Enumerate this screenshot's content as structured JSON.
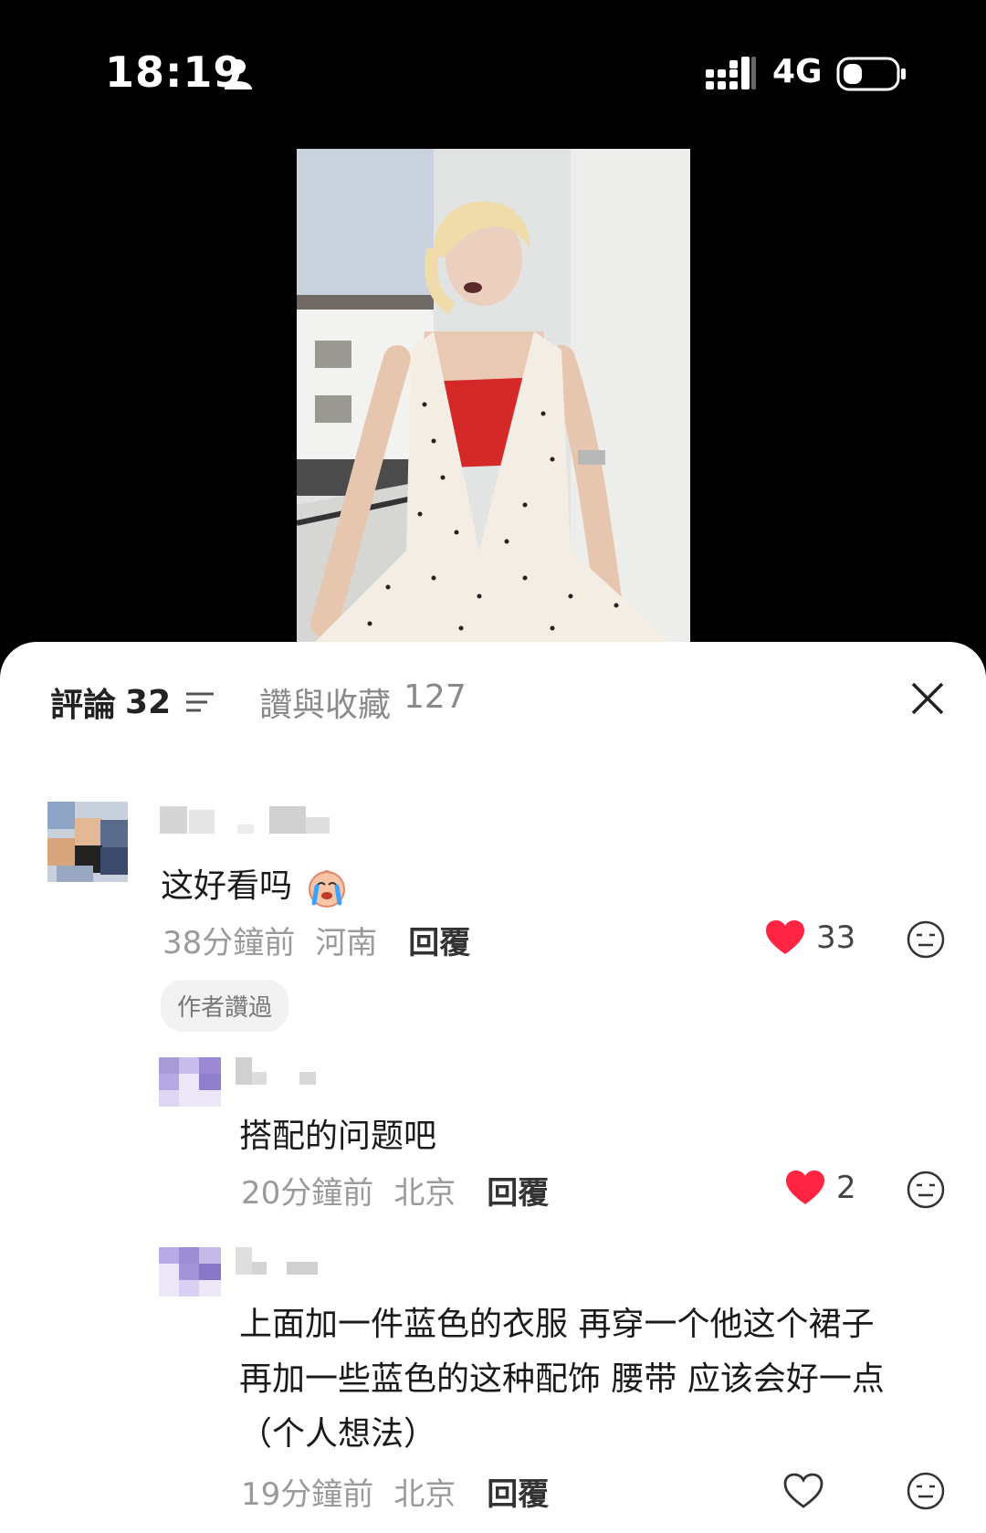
{
  "status": {
    "time": "18:19",
    "network": "4G"
  },
  "tabs": {
    "comments_label": "評論",
    "comments_count": "32",
    "likes_label": "讚與收藏",
    "likes_count": "127"
  },
  "comments": [
    {
      "text": "这好看吗",
      "emoji": "crying-face-icon",
      "time": "38分鐘前",
      "location": "河南",
      "reply": "回覆",
      "likes": "33",
      "liked": true,
      "badge": "作者讚過"
    },
    {
      "text": "搭配的问题吧",
      "time": "20分鐘前",
      "location": "北京",
      "reply": "回覆",
      "likes": "2",
      "liked": true
    },
    {
      "lines": [
        "上面加一件蓝色的衣服 再穿一个他这个裙子",
        "再加一些蓝色的这种配饰 腰带 应该会好一点",
        "（个人想法）"
      ],
      "time": "19分鐘前",
      "location": "北京",
      "reply": "回覆",
      "likes": "",
      "liked": false
    }
  ],
  "colors": {
    "heart": "#ff2442",
    "sheet": "#ffffff",
    "muted": "#9a9a9a"
  }
}
